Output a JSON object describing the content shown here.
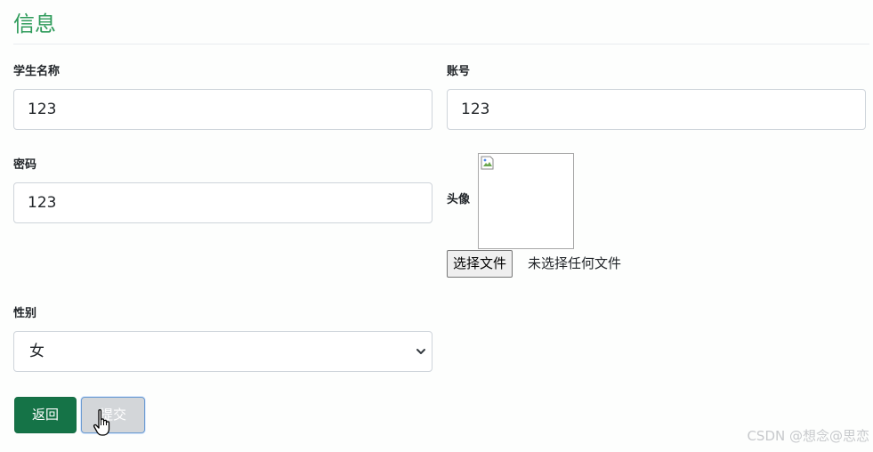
{
  "page": {
    "title": "信息"
  },
  "form": {
    "student_name": {
      "label": "学生名称",
      "value": "123"
    },
    "account": {
      "label": "账号",
      "value": "123"
    },
    "password": {
      "label": "密码",
      "value": "123"
    },
    "avatar": {
      "label": "头像",
      "file_button": "选择文件",
      "file_status": "未选择任何文件"
    },
    "gender": {
      "label": "性别",
      "value": "女"
    }
  },
  "actions": {
    "back": "返回",
    "submit": "提交"
  },
  "watermark": "CSDN @想念@思恋",
  "colors": {
    "title": "#2e9b5a",
    "primary_button": "#157347"
  },
  "icons": {
    "select_caret": "chevron-down-icon",
    "broken_image": "broken-image-icon",
    "cursor": "hand-pointer-cursor"
  }
}
